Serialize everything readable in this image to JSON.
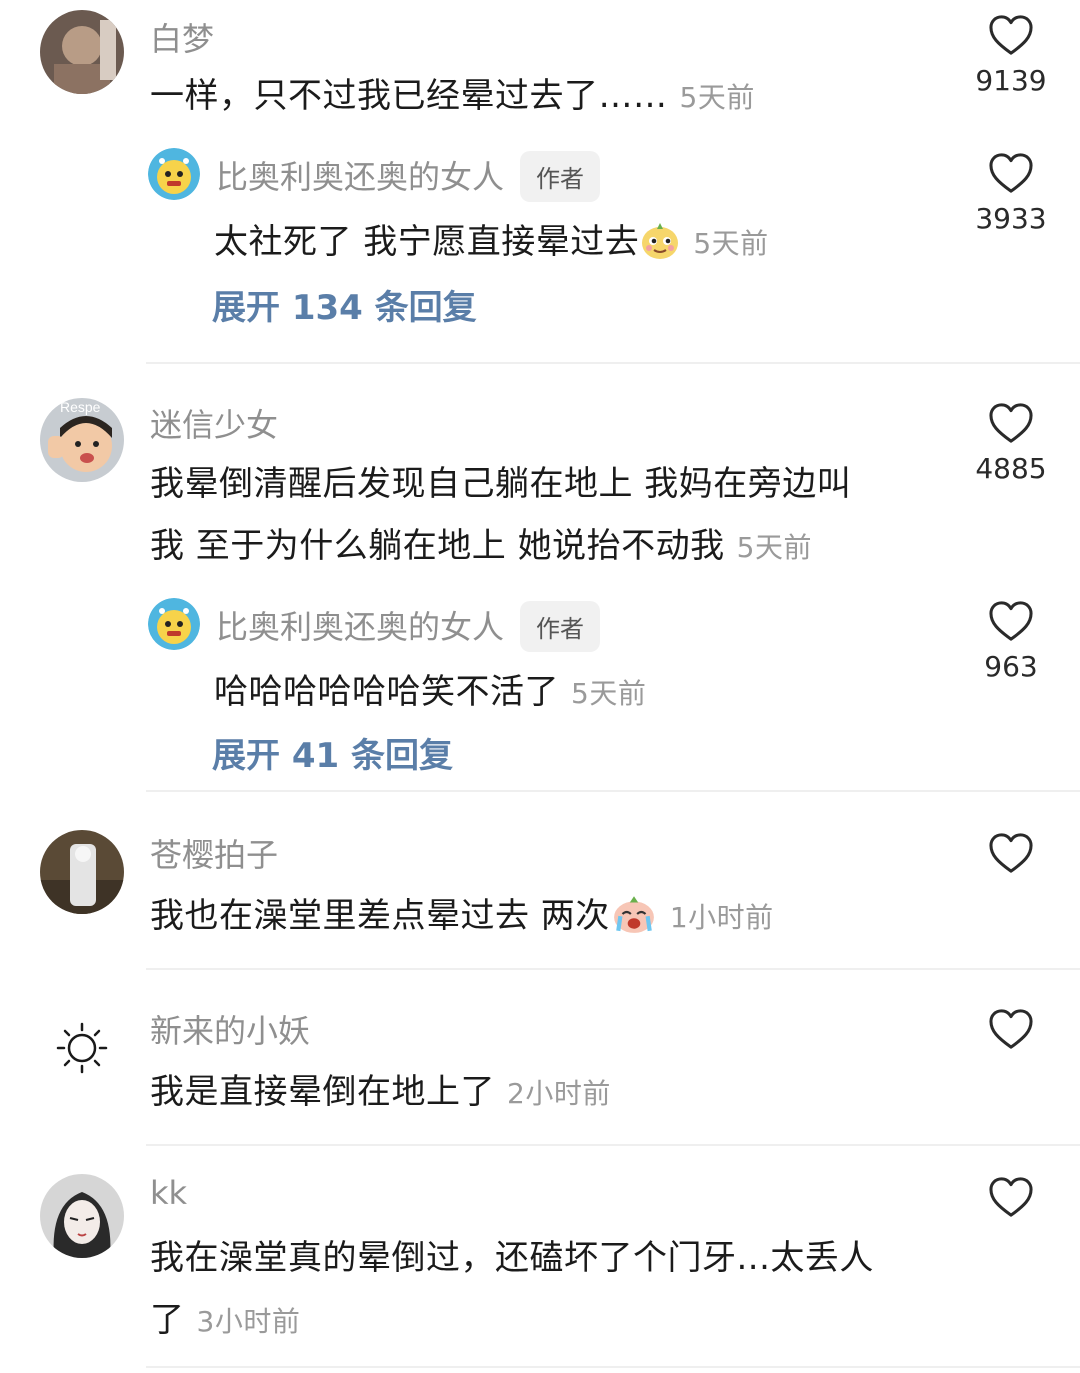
{
  "comments": [
    {
      "username": "白梦",
      "text": "一样，只不过我已经晕过去了……",
      "time": "5天前",
      "likes": "9139",
      "reply": {
        "username": "比奥利奥还奥的女人",
        "badge": "作者",
        "text": "太社死了  我宁愿直接晕过去",
        "time": "5天前",
        "likes": "3933"
      },
      "expand": "展开 134 条回复"
    },
    {
      "username": "迷信少女",
      "avatar_text": "Respe",
      "text_line1": "我晕倒清醒后发现自己躺在地上 我妈在旁边叫",
      "text_line2": "我 至于为什么躺在地上 她说抬不动我",
      "time": "5天前",
      "likes": "4885",
      "reply": {
        "username": "比奥利奥还奥的女人",
        "badge": "作者",
        "text": "哈哈哈哈哈哈笑不活了",
        "time": "5天前",
        "likes": "963"
      },
      "expand": "展开 41 条回复"
    },
    {
      "username": "苍樱拍子",
      "text": "我也在澡堂里差点晕过去 两次",
      "time": "1小时前"
    },
    {
      "username": "新来的小妖",
      "text": "我是直接晕倒在地上了",
      "time": "2小时前"
    },
    {
      "username": "kk",
      "text_line1": "我在澡堂真的晕倒过，还磕坏了个门牙...太丢人",
      "text_line2": "了",
      "time": "3小时前"
    }
  ],
  "colors": {
    "username": "#8f8f8f",
    "text": "#1b1b1b",
    "expand": "#5a7ea8",
    "badge_bg": "#f1f1f1"
  },
  "icons": {
    "like": "heart-outline-icon",
    "emoji_1": "smug-face-emoji",
    "emoji_2": "crying-face-emoji",
    "sun": "sun-icon"
  }
}
